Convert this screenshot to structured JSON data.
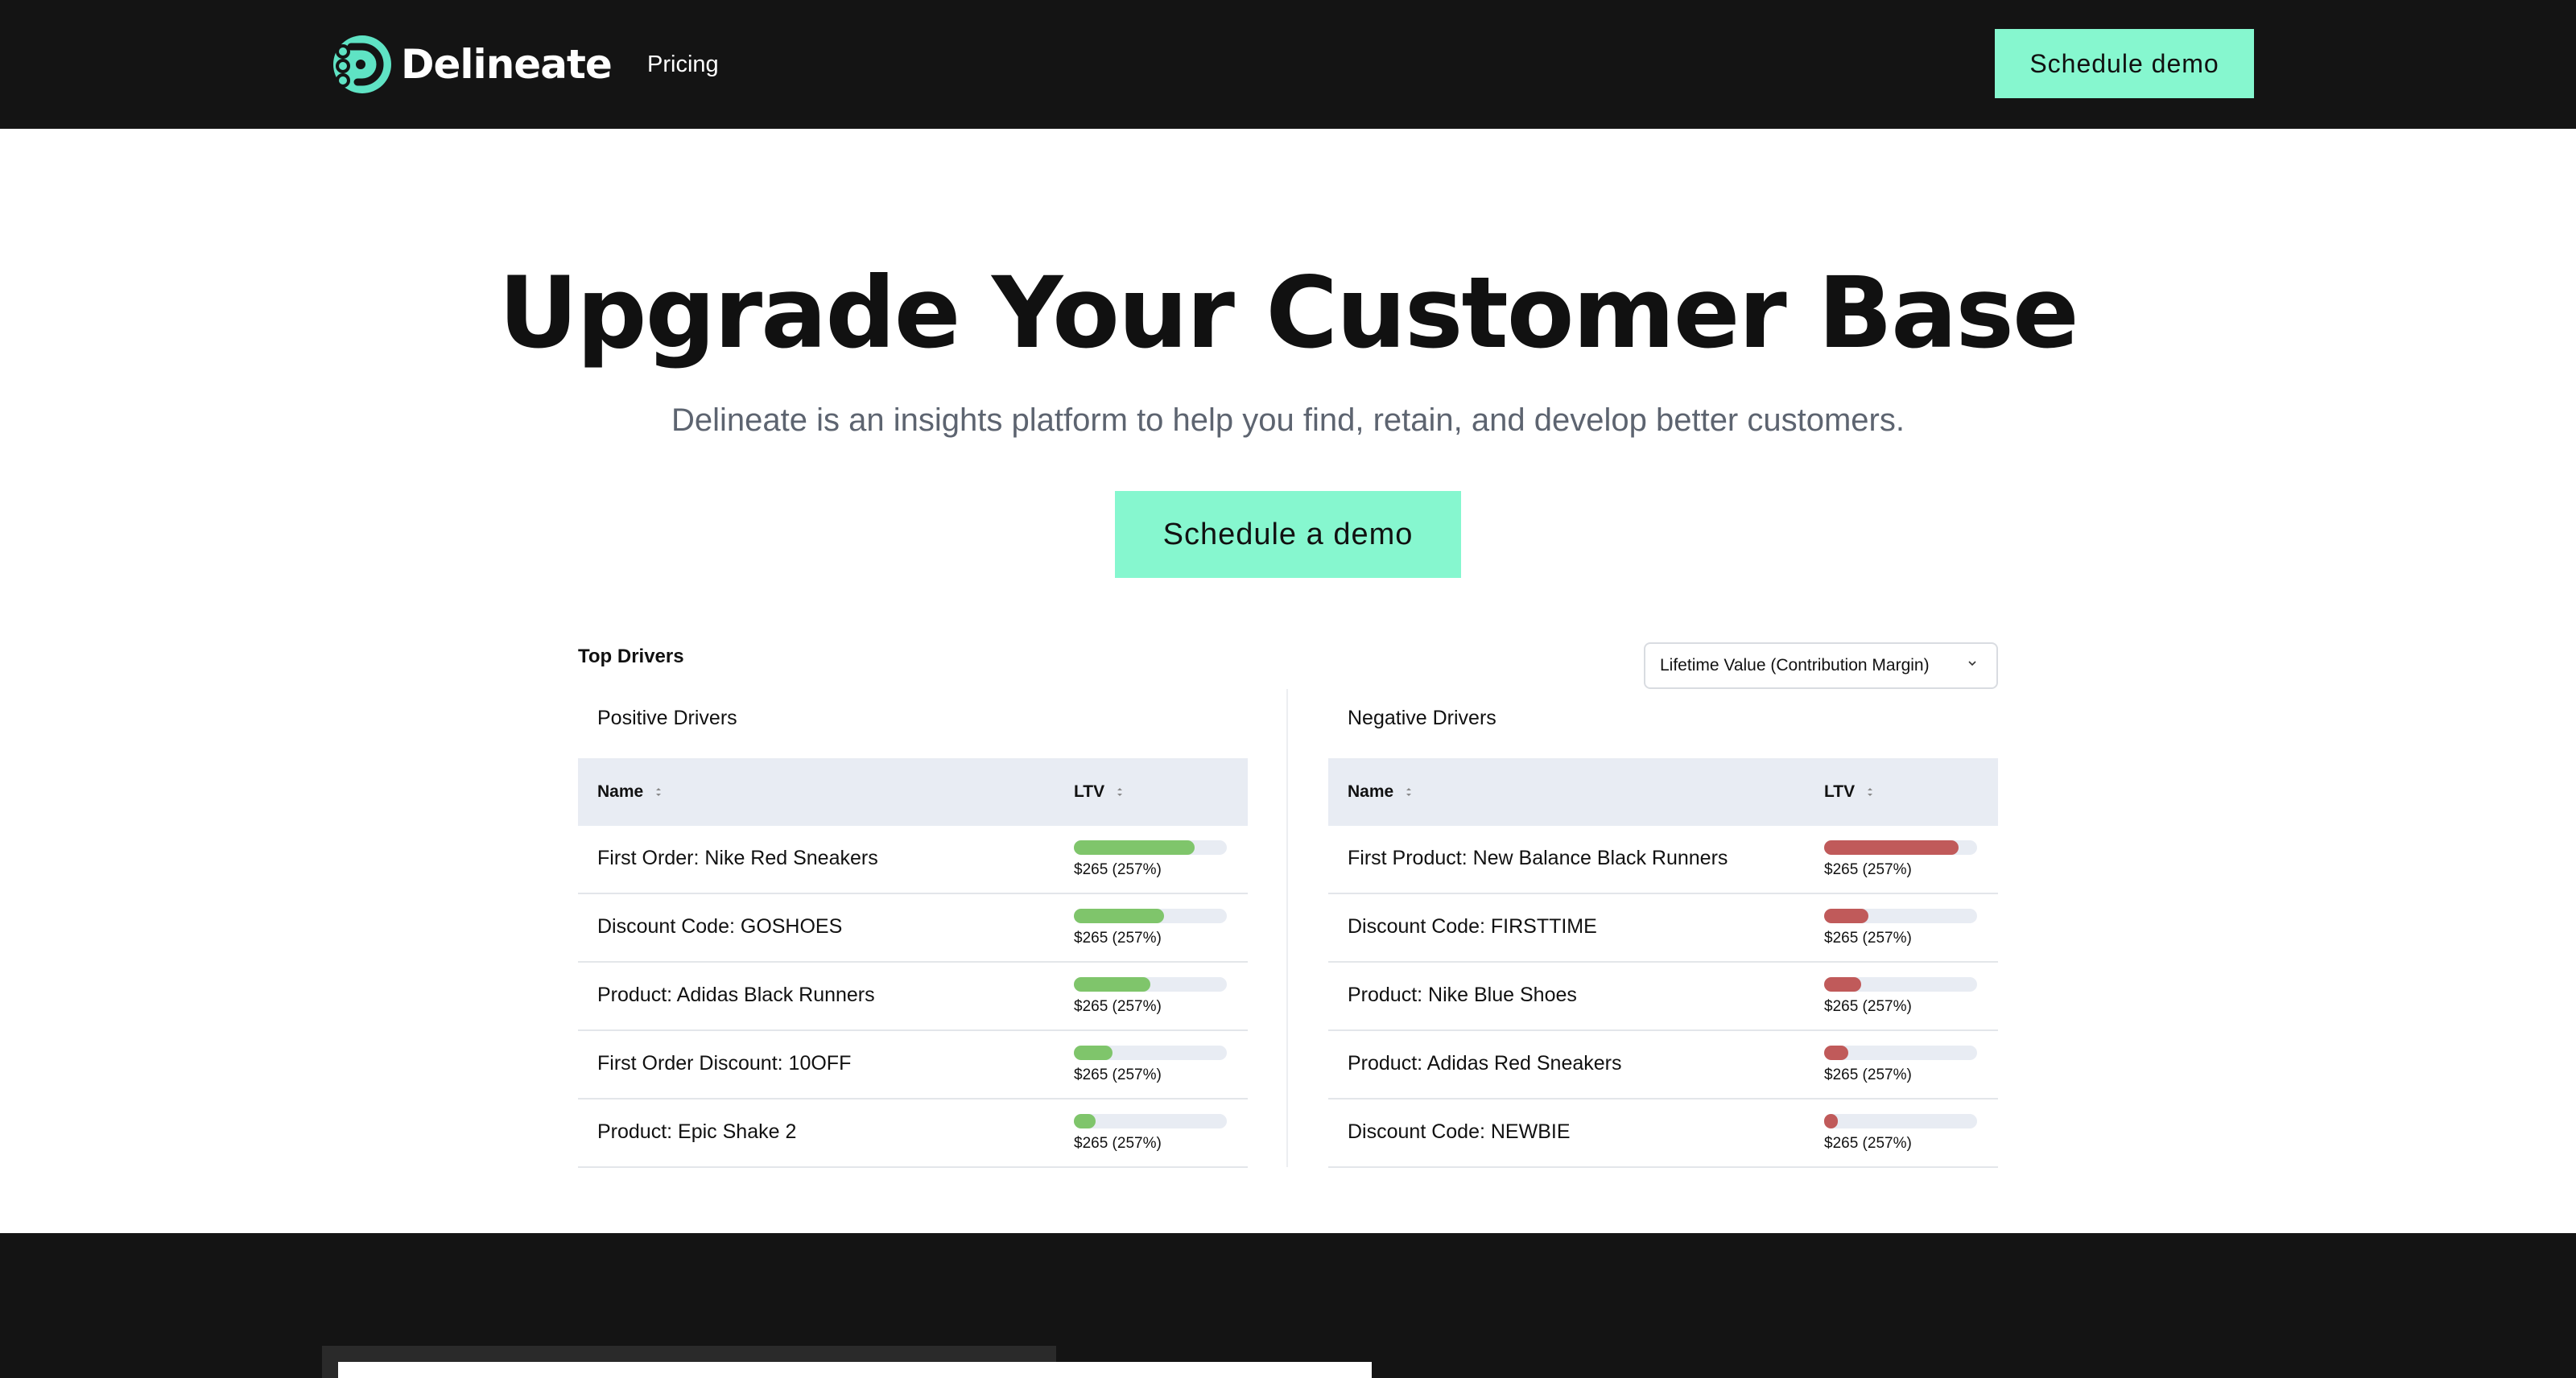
{
  "nav": {
    "brand": "Delineate",
    "links": [
      "Pricing"
    ],
    "cta_label": "Schedule demo",
    "accent": "#86f7cf"
  },
  "hero": {
    "title": "Upgrade Your Customer Base",
    "subtitle": "Delineate is an insights platform to help you find, retain, and develop better customers.",
    "cta_label": "Schedule a demo"
  },
  "dashboard": {
    "title": "Top Drivers",
    "metric_selected": "Lifetime Value (Contribution Margin)",
    "positive": {
      "title": "Positive Drivers",
      "col_name": "Name",
      "col_ltv": "LTV",
      "bar_color": "#7fc56b",
      "rows": [
        {
          "name": "First Order: Nike Red Sneakers",
          "value": "$265 (257%)",
          "fill": 0.79
        },
        {
          "name": "Discount Code: GOSHOES",
          "value": "$265 (257%)",
          "fill": 0.59
        },
        {
          "name": "Product: Adidas Black Runners",
          "value": "$265 (257%)",
          "fill": 0.5
        },
        {
          "name": "First Order Discount: 10OFF",
          "value": "$265 (257%)",
          "fill": 0.25
        },
        {
          "name": "Product: Epic Shake 2",
          "value": "$265 (257%)",
          "fill": 0.14
        }
      ]
    },
    "negative": {
      "title": "Negative Drivers",
      "col_name": "Name",
      "col_ltv": "LTV",
      "bar_color": "#c05a5a",
      "rows": [
        {
          "name": "First Product: New Balance Black Runners",
          "value": "$265 (257%)",
          "fill": 0.88
        },
        {
          "name": "Discount Code: FIRSTTIME",
          "value": "$265 (257%)",
          "fill": 0.29
        },
        {
          "name": "Product: Nike Blue Shoes",
          "value": "$265 (257%)",
          "fill": 0.24
        },
        {
          "name": "Product: Adidas Red Sneakers",
          "value": "$265 (257%)",
          "fill": 0.16
        },
        {
          "name": "Discount Code: NEWBIE",
          "value": "$265 (257%)",
          "fill": 0.09
        }
      ]
    }
  }
}
